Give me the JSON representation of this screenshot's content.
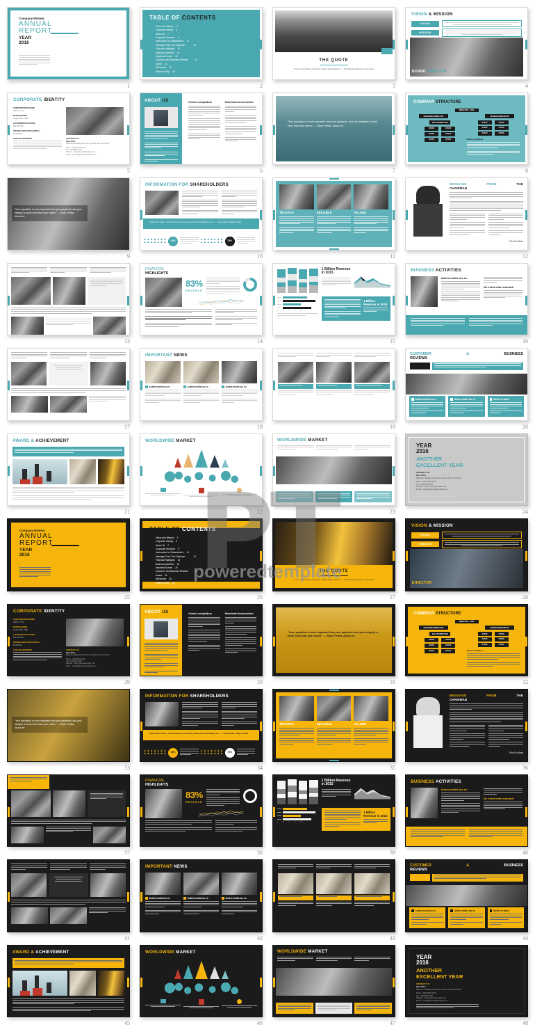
{
  "theme": {
    "accent_teal": "#4aa8b0",
    "accent_yellow": "#f5b50b",
    "dark": "#1b1b1b",
    "grey": "#c9c9c9"
  },
  "watermark": {
    "logo": "PT",
    "text": "poweredtemplate"
  },
  "cover": {
    "eyebrow": "Company Review",
    "line1": "ANNUAL",
    "line2": "REPORT",
    "year_label": "YEAR",
    "year": "2016"
  },
  "toc": {
    "title_a": "TABLE OF",
    "title_b": "CONTENTS",
    "items": [
      {
        "label": "Vision and Mission",
        "page": "3"
      },
      {
        "label": "Corporate Identity",
        "page": "5"
      },
      {
        "label": "About Us",
        "page": "7"
      },
      {
        "label": "Corporate Structure",
        "page": "9"
      },
      {
        "label": "Information for Stakeholder's",
        "page": "11"
      },
      {
        "label": "Message From The Chairman",
        "page": "13"
      },
      {
        "label": "Financial Highlights",
        "page": "16"
      },
      {
        "label": "Business Activities",
        "page": "18"
      },
      {
        "label": "Important Events",
        "page": "20"
      },
      {
        "label": "Customer and Business Reviews",
        "page": "22"
      },
      {
        "label": "Award",
        "page": "24"
      },
      {
        "label": "Milestones",
        "page": "26"
      },
      {
        "label": "Business Map",
        "page": "28"
      }
    ]
  },
  "quote_slide": {
    "title": "THE QUOTE",
    "text": "\"It's not about ideas. It's about making ideas happen.\" —Scott Belsky, Behance co-founder"
  },
  "vision_mission": {
    "title_a": "VISION",
    "title_b": "& MISSION",
    "vision_label": "VISION",
    "mission_label": "MISSION",
    "footer_a": "BOARD",
    "footer_b": "DIRECTOR",
    "footer_yellow": "DIRECTOR"
  },
  "corporate_identity": {
    "title_a": "CORPORATE",
    "title_b": "IDENTITY",
    "fields": [
      {
        "label": "CORPORATION NAME",
        "value": "ABOUT IT Inc."
      },
      {
        "label": "ESTABLISHED",
        "value": "August 18th, 1980"
      },
      {
        "label": "AUTHORIZED CAPITAL",
        "value": "$10.500.000"
      },
      {
        "label": "ISSUED AND PAID CAPITAL",
        "value": "$5.400.000"
      },
      {
        "label": "LINE OF BUSINESS",
        "value": ""
      }
    ],
    "contact_title": "CONTACT US",
    "contact_lines": [
      "Main Office",
      "Millennium Building 43th Street, Florida New York 64012",
      "Phone : 009-80000-1000",
      "Fax : 009-8000-1201",
      "Website : www.poweredtemplate.com",
      "Email : contact@poweredtemplate.com"
    ]
  },
  "about_us": {
    "title_a": "ABOUT",
    "title_b": "US",
    "col1_head": "Omnis voluptibus",
    "col2_head": "Nominati democritum"
  },
  "reputation_quote": {
    "text": "\"Your reputation is more important than your paycheck, and your integrity is worth more than your career.\" — Ryan Freitas, About.me"
  },
  "company_structure": {
    "title_a": "COMPANY",
    "title_b": "STRUCTURE",
    "ceo": "DIRECTOR - CEO",
    "managing": "MANAGING DIRECTOR",
    "hr": "HUMAN RESOURCES",
    "sales": "SALES DIRECTOR",
    "staff": "STAFF",
    "note_head": "Omnis voluptibus"
  },
  "shareholders": {
    "title_a": "INFORMATION FOR",
    "title_b": "SHAREHOLDERS",
    "quote": "\"Chase the vision, not the money, the money will end up following you.\" — Tony Hsieh, Zappos CEO",
    "stat1": "30%",
    "stat2": "70%"
  },
  "three_values": {
    "items": [
      {
        "label": "TRUSTED"
      },
      {
        "label": "RELIABLE"
      },
      {
        "label": "VALUED"
      }
    ]
  },
  "chairman": {
    "title_a": "MESSAGE",
    "title_b": "FROM",
    "title_c": "THE",
    "title_d": "CHAIRMAN",
    "signature": "John  Grisham"
  },
  "financial_highlights": {
    "title_a": "FINANCIAL",
    "title_b": "HIGHLIGHTS",
    "big_value": "83%",
    "big_label": "REVENUE"
  },
  "revenue": {
    "headline_2015": "1 Billion Revenue in 2015",
    "headline_2016": "1 Billion Revenue in 2016"
  },
  "business_activities": {
    "title_a": "BUSINESS",
    "title_b": "ACTIVITIES",
    "head1": "Autem mollis ius eu",
    "head2": "No erant vitae animazh"
  },
  "important_news": {
    "title_a": "IMPORTANT",
    "title_b": "NEWS",
    "cards": [
      {
        "head": "Autem mollis ius eu"
      },
      {
        "head": "Autem mollis ius eu"
      },
      {
        "head": "Autem mollis ius eu"
      }
    ]
  },
  "customer_business": {
    "title_a": "CUSTOMER",
    "title_amp": "&",
    "title_b": "BUSINESS",
    "title_c": "REVIEWS",
    "cards": [
      {
        "head": "Autem mollis ius eu"
      },
      {
        "head": "Autem mollis ius eu"
      },
      {
        "head": "Mollis eu latew"
      }
    ]
  },
  "award": {
    "title_a": "AWARD &",
    "title_b": "ACHIEVEMENT"
  },
  "worldwide_market": {
    "title_a": "WORLDWIDE",
    "title_b": "MARKET"
  },
  "closing": {
    "line1": "YEAR",
    "line2": "2016",
    "line3": "ANOTHER",
    "line4": "EXCELLENT YEAR",
    "contact_title": "CONTACT US",
    "contact_lines": [
      "Main Office",
      "Millennium Building 43th Street, Florida New York 64012",
      "Phone : 009-80000-1000",
      "Fax : 009-8000-1201",
      "Website : www.poweredtemplate.com",
      "Email : contact@poweredtemplate.com"
    ]
  },
  "pages": [
    "1",
    "2",
    "3",
    "4",
    "5",
    "6",
    "7",
    "8",
    "9",
    "10",
    "11",
    "12",
    "13",
    "14",
    "15",
    "16",
    "17",
    "18",
    "19",
    "20",
    "21",
    "22",
    "23",
    "24",
    "25",
    "26",
    "27",
    "28",
    "29",
    "30",
    "31",
    "32",
    "33",
    "34",
    "35",
    "36",
    "37",
    "38",
    "39",
    "40",
    "41",
    "42",
    "43",
    "44",
    "45",
    "46",
    "47",
    "48"
  ]
}
